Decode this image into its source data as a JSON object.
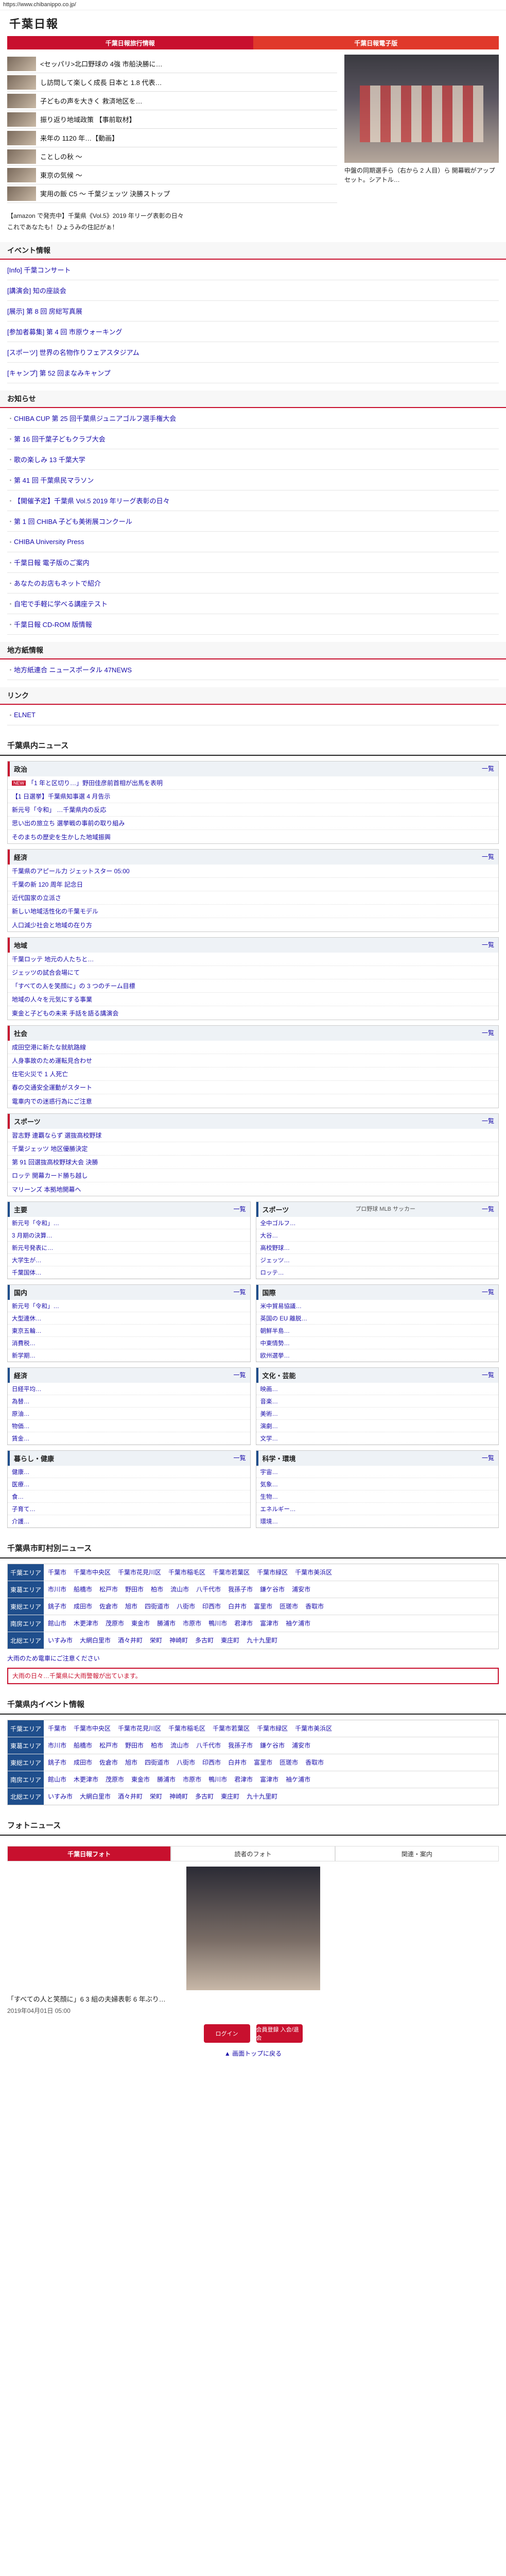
{
  "url": "https://www.chibanippo.co.jp/",
  "brand": "千葉日報",
  "nav": [
    "千葉日報旅行情報",
    "千葉日報電子版"
  ],
  "top_news": [
    "<セッパリ>北口野球の 4強 市船決勝に…",
    "し訪問して楽しく成長 日本と 1.8 代表…",
    "子どもの声を大きく 救済地区を…",
    "振り返り地域政策 【事前取材】",
    "来年の 1120 年…【動画】",
    "ことしの秋 ～",
    "東京の気候 ～",
    "実用の飯 C5 ～ 千葉ジェッツ 決勝ストップ"
  ],
  "feature": {
    "caption": "中盤の同期選手ら（右から 2 人目）ら 開幕戦がアップセット。シアトル…"
  },
  "promos": [
    "【amazon で発売中】千葉県《Vol.5》2019 年リーグ表彰の日々",
    "これであなたも！ひょうみの住記がぁ！"
  ],
  "events_title": "イベント情報",
  "events": [
    "[Info] 千葉コンサート",
    "[講演会] 知の座談会",
    "[展示] 第 8 回 房総写真展",
    "[参加者募集] 第 4 回 市原ウォーキング",
    "[スポーツ] 世界の名物作りフェアスタジアム",
    "[キャンプ] 第 52 回まなみキャンプ"
  ],
  "notices_title": "お知らせ",
  "notices": [
    "CHIBA CUP 第 25 回千葉県ジュニアゴルフ選手権大会",
    "第 16 回千葉子どもクラブ大会",
    "歌の楽しみ 13 千葉大学",
    "第 41 回 千葉県民マラソン",
    "【開催予定】千葉県 Vol.5 2019 年リーグ表彰の日々",
    "第 1 回 CHIBA 子ども美術展コンクール",
    "CHIBA University Press",
    "千葉日報 電子版のご案内",
    "あなたのお店もネットで紹介",
    "自宅で手軽に学べる講座テスト",
    "千葉日報 CD-ROM 版情報"
  ],
  "region_title": "地方紙情報",
  "region": [
    "地方紙連合 ニュースポータル 47NEWS"
  ],
  "links_title": "リンク",
  "links": [
    "ELNET"
  ],
  "local_news_title": "千葉県内ニュース",
  "categories": [
    {
      "name": "政治",
      "more": "一覧",
      "items": [
        "「1 年と区切り…」野田佳彦前首相が出馬を表明",
        "【1 日選挙】千葉県知事選 4 月告示",
        "新元号「令和」 …千葉県内の反応",
        "思い出の旅立ち 選挙戦の事前の取り組み",
        "そのまちの歴史を生かした地域振興"
      ]
    },
    {
      "name": "経済",
      "more": "一覧",
      "items": [
        "千葉県のアピール力 ジェットスター 05:00",
        "千葉の新 120 周年 記念日",
        "近代国家の立派さ",
        "新しい地域活性化の千葉モデル",
        "人口減少社会と地域の在り方"
      ]
    },
    {
      "name": "地域",
      "more": "一覧",
      "items": [
        "千葉ロッテ 地元の人たちと…",
        "ジェッツの試合会場にて",
        "「すべての人を笑顔に」の 3 つのチーム目標",
        "地域の人々を元気にする事業",
        "東金と子どもの未来 手話を語る講演会"
      ]
    },
    {
      "name": "社会",
      "more": "一覧",
      "items": [
        "成田空港に新たな就航路線",
        "人身事故のため運転見合わせ",
        "住宅火災で 1 人死亡",
        "春の交通安全運動がスタート",
        "電車内での迷惑行為にご注意"
      ]
    },
    {
      "name": "スポーツ",
      "more": "一覧",
      "items": [
        "習志野 連覇ならず 選抜高校野球",
        "千葉ジェッツ 地区優勝決定",
        "第 91 回選抜高校野球大会 決勝",
        "ロッテ 開幕カード勝ち越し",
        "マリーンズ 本拠地開幕へ"
      ]
    }
  ],
  "grid": [
    {
      "name": "主要",
      "more": "一覧",
      "items": [
        "新元号「令和」…",
        "3 月期の決算…",
        "新元号発表に…",
        "大学生が…",
        "千葉国体…"
      ]
    },
    {
      "name": "スポーツ",
      "sub": "プロ野球 MLB サッカー",
      "more": "一覧",
      "items": [
        "全中ゴルフ…",
        "大谷…",
        "高校野球…",
        "ジェッツ…",
        "ロッテ…"
      ]
    },
    {
      "name": "国内",
      "more": "一覧",
      "items": [
        "新元号「令和」…",
        "大型連休…",
        "東京五輪…",
        "消費税…",
        "新学期…"
      ]
    },
    {
      "name": "国際",
      "more": "一覧",
      "items": [
        "米中貿易協議…",
        "英国の EU 離脱…",
        "朝鮮半島…",
        "中東情勢…",
        "欧州選挙…"
      ]
    },
    {
      "name": "経済",
      "more": "一覧",
      "items": [
        "日経平均…",
        "為替…",
        "原油…",
        "物価…",
        "賃金…"
      ]
    },
    {
      "name": "文化・芸能",
      "more": "一覧",
      "items": [
        "映画…",
        "音楽…",
        "美術…",
        "演劇…",
        "文学…"
      ]
    },
    {
      "name": "暮らし・健康",
      "more": "一覧",
      "items": [
        "健康…",
        "医療…",
        "食…",
        "子育て…",
        "介護…"
      ]
    },
    {
      "name": "科学・環境",
      "more": "一覧",
      "items": [
        "宇宙…",
        "気象…",
        "生物…",
        "エネルギー…",
        "環境…"
      ]
    }
  ],
  "city_news_title": "千葉県市町村別ニュース",
  "city_rows": [
    {
      "k": "千葉エリア",
      "v": [
        "千葉市",
        "千葉市中央区",
        "千葉市花見川区",
        "千葉市稲毛区",
        "千葉市若葉区",
        "千葉市緑区",
        "千葉市美浜区"
      ]
    },
    {
      "k": "東葛エリア",
      "v": [
        "市川市",
        "船橋市",
        "松戸市",
        "野田市",
        "柏市",
        "流山市",
        "八千代市",
        "我孫子市",
        "鎌ケ谷市",
        "浦安市"
      ]
    },
    {
      "k": "東総エリア",
      "v": [
        "銚子市",
        "成田市",
        "佐倉市",
        "旭市",
        "四街道市",
        "八街市",
        "印西市",
        "白井市",
        "富里市",
        "匝瑳市",
        "香取市"
      ]
    },
    {
      "k": "南房エリア",
      "v": [
        "館山市",
        "木更津市",
        "茂原市",
        "東金市",
        "勝浦市",
        "市原市",
        "鴨川市",
        "君津市",
        "富津市",
        "袖ケ浦市"
      ]
    },
    {
      "k": "北総エリア",
      "v": [
        "いすみ市",
        "大網白里市",
        "酒々井町",
        "栄町",
        "神崎町",
        "多古町",
        "東庄町",
        "九十九里町"
      ]
    }
  ],
  "note1": "大雨のため電車にご注意ください",
  "note2": "大雨の日々…千葉県に大雨警報が出ています。",
  "city_event_title": "千葉県内イベント情報",
  "event_rows": [
    {
      "k": "千葉エリア",
      "v": [
        "千葉市",
        "千葉市中央区",
        "千葉市花見川区",
        "千葉市稲毛区",
        "千葉市若葉区",
        "千葉市緑区",
        "千葉市美浜区"
      ]
    },
    {
      "k": "東葛エリア",
      "v": [
        "市川市",
        "船橋市",
        "松戸市",
        "野田市",
        "柏市",
        "流山市",
        "八千代市",
        "我孫子市",
        "鎌ケ谷市",
        "浦安市"
      ]
    },
    {
      "k": "東総エリア",
      "v": [
        "銚子市",
        "成田市",
        "佐倉市",
        "旭市",
        "四街道市",
        "八街市",
        "印西市",
        "白井市",
        "富里市",
        "匝瑳市",
        "香取市"
      ]
    },
    {
      "k": "南房エリア",
      "v": [
        "館山市",
        "木更津市",
        "茂原市",
        "東金市",
        "勝浦市",
        "市原市",
        "鴨川市",
        "君津市",
        "富津市",
        "袖ケ浦市"
      ]
    },
    {
      "k": "北総エリア",
      "v": [
        "いすみ市",
        "大網白里市",
        "酒々井町",
        "栄町",
        "神崎町",
        "多古町",
        "東庄町",
        "九十九里町"
      ]
    }
  ],
  "photo_title": "フォトニュース",
  "photo_tabs": [
    "千葉日報フォト",
    "読者のフォト",
    "関連・案内"
  ],
  "photo_caption": "「すべての人と笑顔に」6 3 組の夫婦表彰 6 年ぶり…",
  "photo_date": "2019年04月01日 05:00",
  "buttons": [
    "ログイン",
    "会員登録 入会/退会"
  ],
  "foot_link": "▲ 画面トップに戻る"
}
